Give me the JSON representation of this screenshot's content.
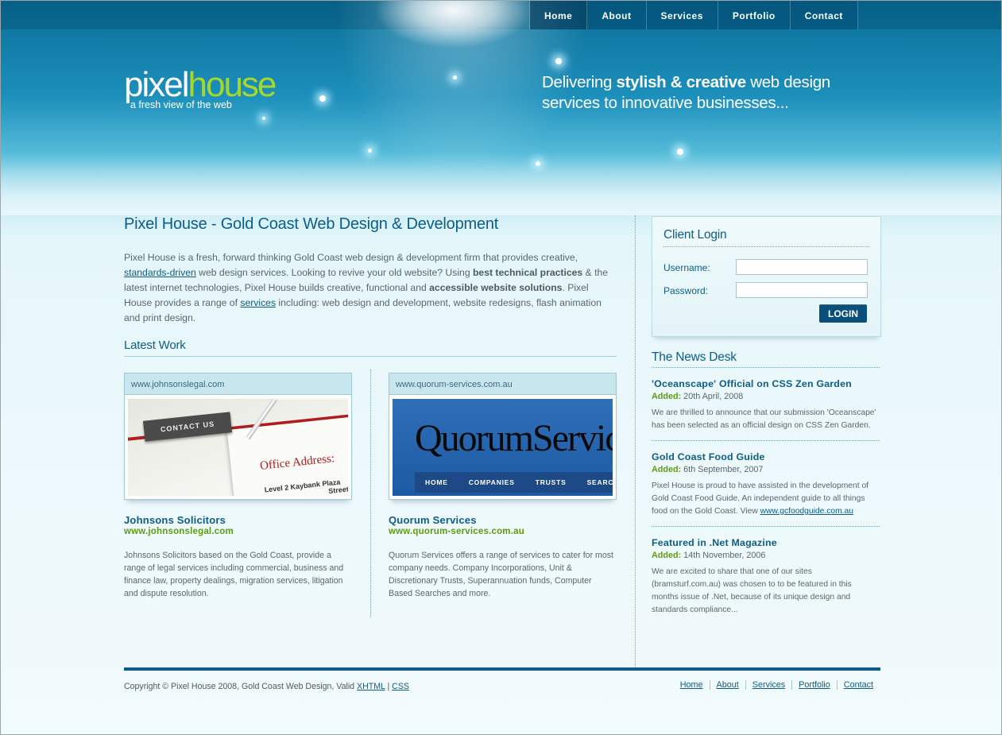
{
  "nav": [
    "Home",
    "About",
    "Services",
    "Portfolio",
    "Contact"
  ],
  "logo": {
    "pixel": "pixel",
    "house": "house",
    "tagline": "a fresh view of the web"
  },
  "slogan": {
    "pre": "Delivering ",
    "bold": "stylish & creative",
    "post": " web design",
    "line2": "services to innovative businesses..."
  },
  "intro": {
    "title": "Pixel House - Gold Coast Web Design & Development",
    "p1": "Pixel House is a fresh, forward thinking Gold Coast web design & development firm that provides creative, ",
    "link1": "standards-driven",
    "p2": " web design services. Looking to revive your old website? Using ",
    "bold1": "best technical practices",
    "p3": " & the latest internet technologies, Pixel House builds creative, functional and ",
    "bold2": "accessible website solutions",
    "p4": ". Pixel House provides a range of ",
    "link2": "services",
    "p5": " including: web design and development, website redesigns, flash animation and print design."
  },
  "latest_work": {
    "heading": "Latest Work",
    "items": [
      {
        "url": "www.johnsonslegal.com",
        "name": "Johnsons Solicitors",
        "site": "www.johnsonslegal.com",
        "desc": "Johnsons Solicitors based on the Gold Coast, provide a range of legal services including commercial, business and finance law, property dealings, migration services, litigation and dispute resolution.",
        "shot": {
          "button": "CONTACT US",
          "office": "Office Address:",
          "addr1": "Level 2 Kaybank Plaza",
          "addr2": "Street"
        }
      },
      {
        "url": "www.quorum-services.com.au",
        "name": "Quorum Services",
        "site": "www.quorum-services.com.au",
        "desc": "Quorum Services offers a range of services to cater for most company needs. Company Incorporations, Unit & Discretionary Trusts, Superannuation funds, Computer Based Searches and more.",
        "shot": {
          "brand": "QuorumServic",
          "nav": [
            "HOME",
            "COMPANIES",
            "TRUSTS",
            "SEARC"
          ]
        }
      }
    ]
  },
  "login": {
    "title": "Client Login",
    "username_label": "Username:",
    "password_label": "Password:",
    "button": "LOGIN"
  },
  "news": {
    "heading": "The News Desk",
    "items": [
      {
        "title": "'Oceanscape' Official on CSS Zen Garden",
        "added_label": "Added:",
        "date": " 20th April, 2008",
        "body": "We are thrilled to announce that our submission 'Oceanscape' has been selected as an official design on CSS Zen Garden."
      },
      {
        "title": "Gold Coast Food Guide",
        "added_label": "Added:",
        "date": " 6th September, 2007",
        "body": "Pixel House is proud to have assisted in the development of Gold Coast Food Guide. An independent guide to all things food on the Gold Coast. View ",
        "link": "www.gcfoodguide.com.au"
      },
      {
        "title": "Featured in .Net Magazine",
        "added_label": "Added:",
        "date": " 14th November, 2006",
        "body": "We are excited to share that one of our sites (bramsturf.com.au) was chosen to to be featured in this months issue of .Net, because of its unique design and standards compliance..."
      }
    ]
  },
  "footer": {
    "copy": "Copyright © Pixel House 2008, Gold Coast Web Design, Valid ",
    "xhtml": "XHTML",
    "sep": " | ",
    "css": "CSS",
    "links": [
      "Home",
      "About",
      "Services",
      "Portfolio",
      "Contact"
    ]
  },
  "colors": {
    "brand_blue": "#0c5d8a",
    "accent_green": "#a6d82b",
    "date_green": "#5f9b0f",
    "footer_bar": "#0e5a8a"
  }
}
